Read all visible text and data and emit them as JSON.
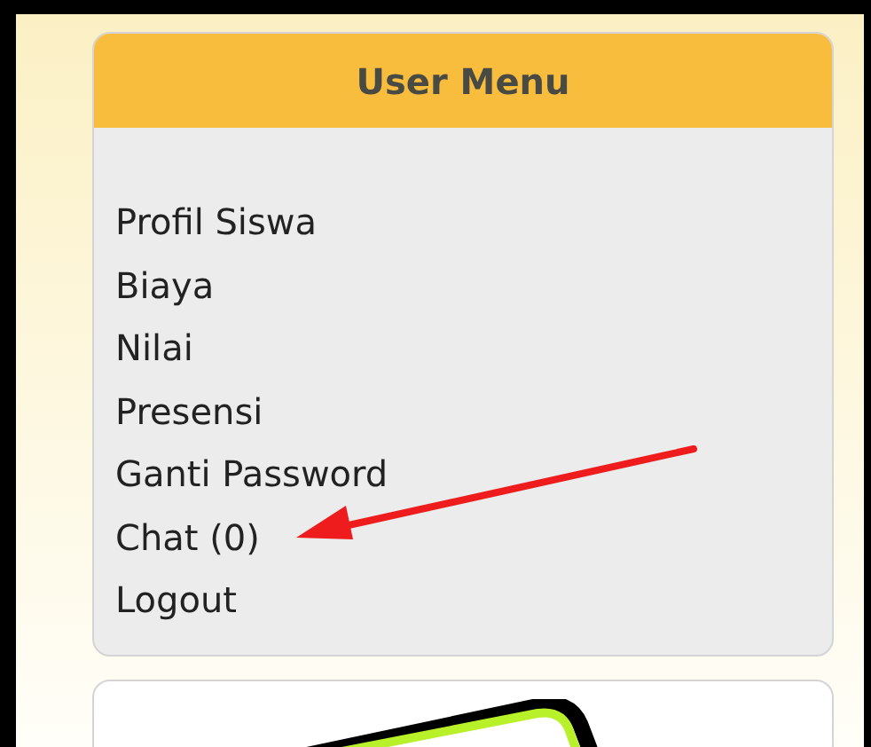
{
  "user_menu": {
    "title": "User Menu",
    "items": [
      {
        "label": "Profil Siswa"
      },
      {
        "label": "Biaya"
      },
      {
        "label": "Nilai"
      },
      {
        "label": "Presensi"
      },
      {
        "label": "Ganti Password"
      },
      {
        "label": "Chat (0)"
      },
      {
        "label": "Logout"
      }
    ]
  }
}
